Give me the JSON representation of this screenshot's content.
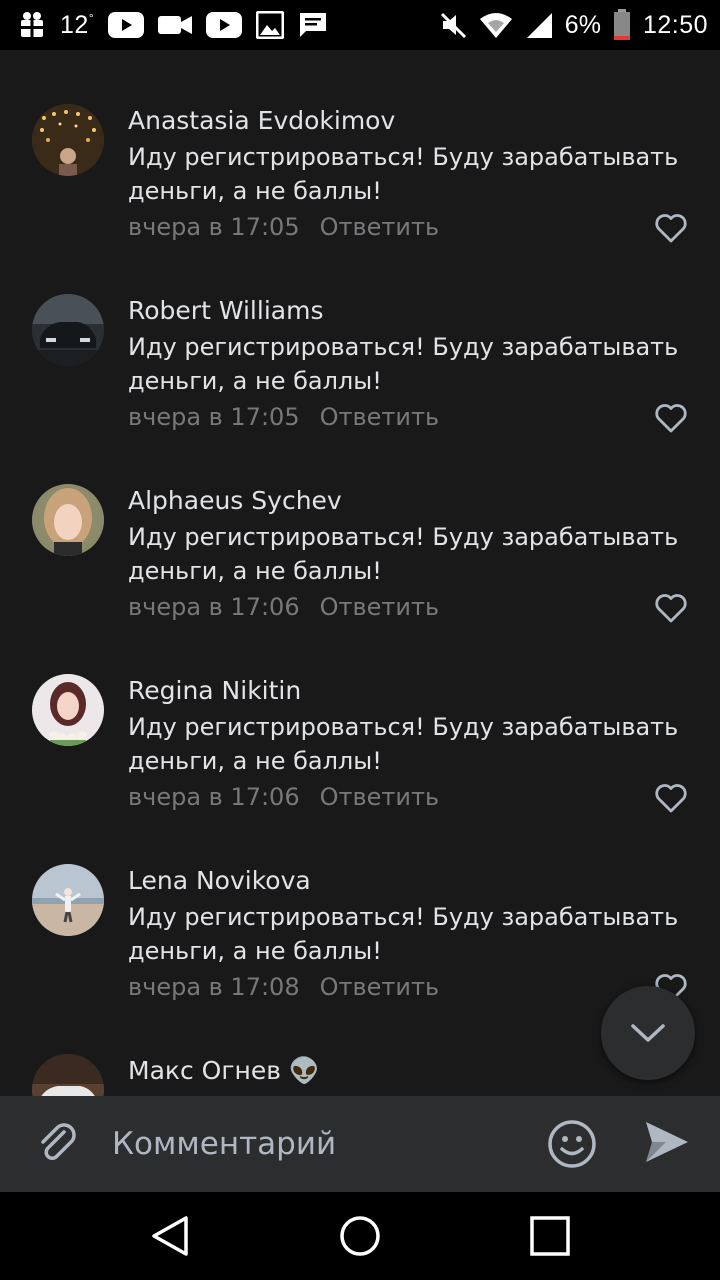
{
  "status_bar": {
    "temperature": "12",
    "temperature_unit": "°",
    "battery": "6%",
    "time": "12:50"
  },
  "comments": [
    {
      "author": "Anastasia Evdokimov",
      "text": "Иду регистрироваться! Буду зарабатывать деньги, а не баллы!",
      "time": "вчера в 17:05",
      "reply_label": "Ответить"
    },
    {
      "author": "Robert Williams",
      "text": "Иду регистрироваться! Буду зарабатывать деньги, а не баллы!",
      "time": "вчера в 17:05",
      "reply_label": "Ответить"
    },
    {
      "author": "Alphaeus Sychev",
      "text": "Иду регистрироваться! Буду зарабатывать деньги, а не баллы!",
      "time": "вчера в 17:06",
      "reply_label": "Ответить"
    },
    {
      "author": "Regina Nikitin",
      "text": "Иду регистрироваться! Буду зарабатывать деньги, а не баллы!",
      "time": "вчера в 17:06",
      "reply_label": "Ответить"
    },
    {
      "author": "Lena Novikova",
      "text": "Иду регистрироваться! Буду зарабатывать деньги, а не баллы!",
      "time": "вчера в 17:08",
      "reply_label": "Ответить"
    },
    {
      "author": "Макс Огнев 👽",
      "text": "",
      "time": "",
      "reply_label": ""
    }
  ],
  "composer": {
    "placeholder": "Комментарий"
  },
  "icons": {
    "attach": "paperclip-icon",
    "emoji": "smiley-icon",
    "send": "send-icon",
    "scroll_down": "chevron-down-icon",
    "like": "heart-outline-icon"
  },
  "colors": {
    "background": "#19191a",
    "text_primary": "#e1e3e6",
    "text_secondary": "#76787a",
    "composer_bg": "#2c2d2e"
  }
}
